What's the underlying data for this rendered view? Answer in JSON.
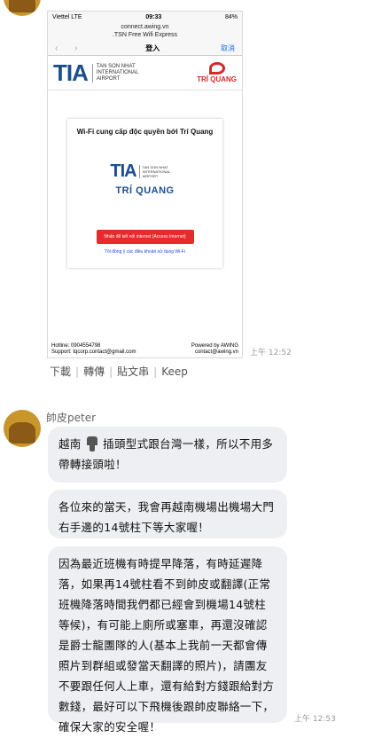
{
  "message1": {
    "image": {
      "status_carrier": "Viettel  LTE",
      "status_time": "09:33",
      "status_battery": "84%",
      "url_host": "connect.awing.vn",
      "url_title": ".TSN Free Wifi Express",
      "nav_title": "登入",
      "nav_cancel": "取消",
      "brand_logo": "TIA",
      "brand_airport": "TAN SON NHAT INTERNATIONAL AIRPORT",
      "brand_partner": "TRÍ QUANG",
      "card_heading": "Wi-Fi cung cấp độc quyền bởi Trí Quang",
      "card_logo": "TIA",
      "card_airport": "TAN SON NHAT INTERNATIONAL AIRPORT",
      "card_partner": "TRÍ QUANG",
      "access_button": "Nhấn để kết nối internet (Access Internet)",
      "terms_link": "Tôi đồng ý các điều khoản sử dụng Wi-Fi",
      "footer_hotline": "Hotline: 0904554798",
      "footer_support": "Support: tqcorp.contact@gmail.com",
      "footer_powered": "Powered by AWING",
      "footer_contact": "contact@awing.vn"
    },
    "timestamp": "上午 12:52"
  },
  "image_actions": [
    "下載",
    "轉傳",
    "貼文串",
    "Keep"
  ],
  "message2": {
    "sender": "帥皮peter",
    "bubble1_before": "越南",
    "bubble1_after": "插頭型式跟台灣一樣，所以不用多帶轉接頭啦！",
    "bubble2": "各位來的當天，我會再越南機場出機場大門右手邊的14號柱下等大家喔！",
    "bubble3": "因為最近班機有時提早降落，有時延遲降落，如果再14號柱看不到帥皮或翻譯(正常班機降落時間我們都已經會到機場14號柱等候)，有可能上廁所或塞車，再還沒確認是爵士龍團隊的人(基本上我前一天都會傳照片到群組或發當天翻譯的照片)，請團友不要跟任何人上車，還有給對方錢跟給對方數錢，最好可以下飛機後跟帥皮聯絡一下，確保大家的安全喔！",
    "timestamp": "上午 12:53"
  }
}
